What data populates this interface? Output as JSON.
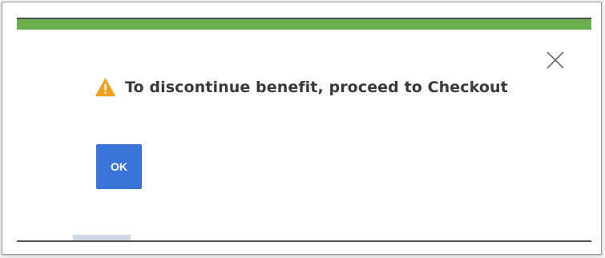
{
  "dialog": {
    "message": "To discontinue benefit, proceed to Checkout",
    "ok_label": "OK",
    "icons": {
      "warning": "warning-icon",
      "close": "close-icon"
    }
  },
  "colors": {
    "accent_bar": "#6ab04c",
    "ok_button": "#3b74d8",
    "warning": "#f0a01c",
    "message_text": "#3a3a3a"
  }
}
